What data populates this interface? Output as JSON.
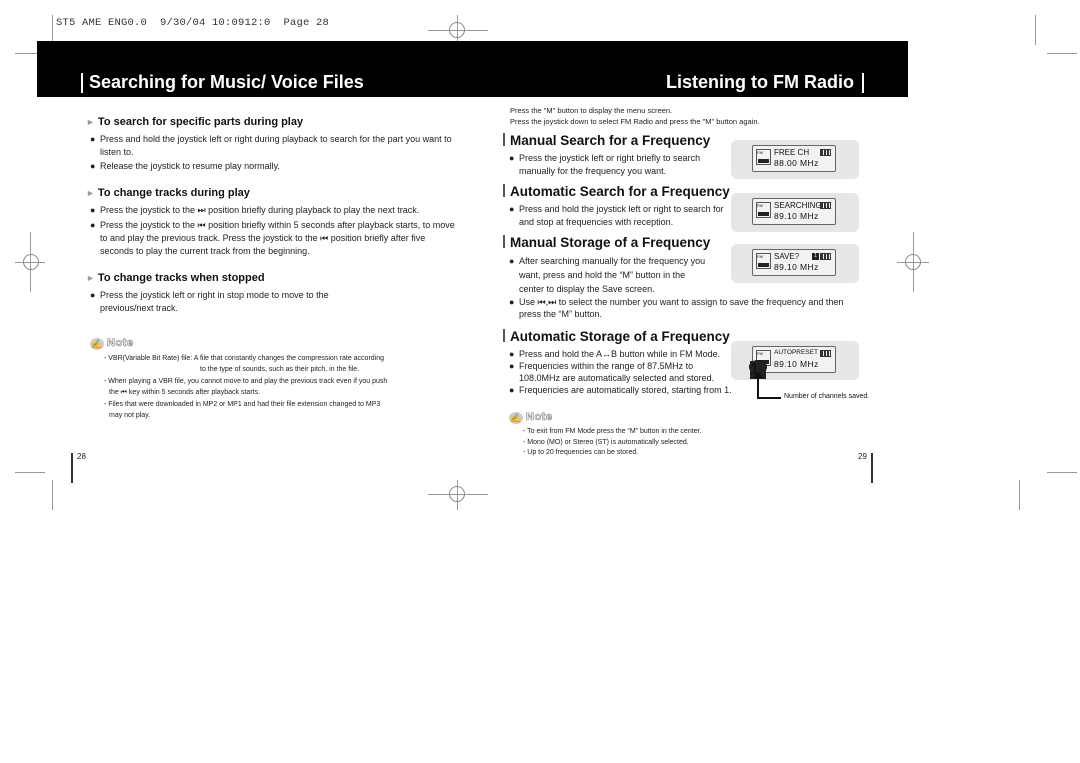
{
  "slug": "ST5 AME ENG0.0  9/30/04 10:0912:0  Page 28",
  "left_page": {
    "title": "Searching for Music/ Voice Files",
    "sections": [
      {
        "heading": "To search for specific parts during play",
        "bullets": [
          "Press and hold the joystick left or right during playback to search for the part you want to listen to.",
          "Release the joystick to resume play normally."
        ]
      },
      {
        "heading": "To change tracks during play",
        "bullets": [
          "Press the joystick to the ⏭ position briefly during playback to play the next track.",
          "Press the joystick to the ⏮ position briefly within 5 seconds after playback starts, to move to and play the previous track. Press the joystick to the ⏮ position briefly after five seconds to play the current track from the beginning."
        ]
      },
      {
        "heading": "To change tracks when stopped",
        "bullets": [
          "Press the joystick left or right in stop mode to move to the previous/next track."
        ]
      }
    ],
    "note": {
      "title": "Note",
      "lines": [
        "- VBR(Variable Bit Rate) file: A file that constantly changes the compression rate according",
        "to the type of sounds, such as their pitch, in the file.",
        "- When playing a VBR file, you cannot move to and play the previous track even if you push",
        "the ⏮ key within 5 seconds after playback starts.",
        "- Files that were downloaded in MP2 or MP1 and had their file extension changed to MP3",
        "may not play."
      ]
    },
    "page_number": "28"
  },
  "right_page": {
    "title": "Listening to FM Radio",
    "intro": [
      "Press the \"M\" button to display the menu screen.",
      "Press the joystick down to select FM Radio and press the \"M\" button again."
    ],
    "sections": [
      {
        "heading": "Manual Search for a Frequency",
        "bullets": [
          "Press the joystick left or right briefly to search manually for the frequency you want."
        ],
        "lcd": {
          "line1": "FREE  CH",
          "line2": "88.00 MHz"
        }
      },
      {
        "heading": "Automatic Search for a Frequency",
        "bullets": [
          "Press and hold the joystick left or right to search for and stop at frequencies with reception."
        ],
        "lcd": {
          "line1": "SEARCHING",
          "line2": "89.10 MHz"
        }
      },
      {
        "heading": "Manual Storage of a Frequency",
        "bullets": [
          "After searching manually for the frequency you want, press and hold the “M” button in the center to display the Save screen.",
          "Use ⏮,⏭ to select the number you want to assign to save the frequency and then press the “M” button."
        ],
        "lcd": {
          "line1": "SAVE?",
          "line2": "89.10 MHz",
          "preset": "1"
        }
      },
      {
        "heading": "Automatic Storage of a Frequency",
        "bullets": [
          "Press and hold the A↔B button while in FM Mode.",
          "Frequencies within the range of 87.5MHz to 108.0MHz are automatically selected and stored.",
          "Frequencies are automatically stored, starting from 1."
        ],
        "lcd": {
          "line1": "AUTOPRESET",
          "line2": "89.10 MHz",
          "preset": "1"
        },
        "callout": "Number of channels saved."
      }
    ],
    "note": {
      "title": "Note",
      "lines": [
        "- To exit from FM Mode press the “M” button in the center.",
        "- Mono (MO) or Stereo (ST) is automatically selected.",
        "- Up to 20 frequencies can be stored."
      ]
    },
    "page_number": "29"
  },
  "lcd_fm_label": "FM",
  "icons": {
    "bullet": "●",
    "arrow": "►",
    "note": "✍"
  }
}
